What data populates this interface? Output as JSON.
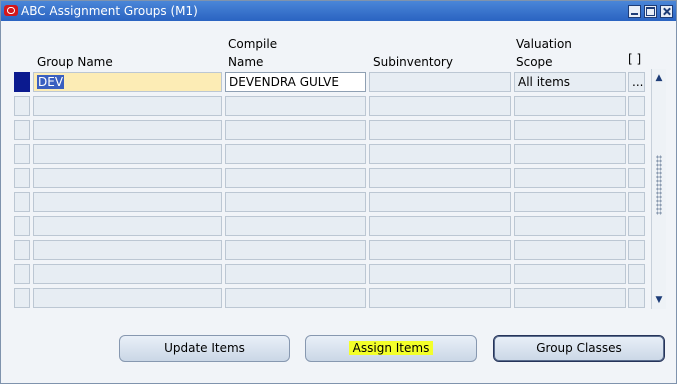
{
  "window": {
    "title": "ABC Assignment Groups (M1)",
    "controls": [
      "minimize-icon",
      "maximize-icon",
      "close-icon"
    ]
  },
  "table": {
    "headers": {
      "group_name": "Group Name",
      "compile_name_line1": "Compile",
      "compile_name_line2": "Name",
      "subinventory": "Subinventory",
      "valuation_line1": "Valuation",
      "valuation_line2": "Scope",
      "flex": "[ ]"
    },
    "rows": [
      {
        "group_name": "DEV",
        "compile_name": "DEVENDRA GULVE",
        "subinventory": "",
        "valuation_scope": "All items",
        "flex": "..."
      },
      {
        "group_name": "",
        "compile_name": "",
        "subinventory": "",
        "valuation_scope": "",
        "flex": ""
      },
      {
        "group_name": "",
        "compile_name": "",
        "subinventory": "",
        "valuation_scope": "",
        "flex": ""
      },
      {
        "group_name": "",
        "compile_name": "",
        "subinventory": "",
        "valuation_scope": "",
        "flex": ""
      },
      {
        "group_name": "",
        "compile_name": "",
        "subinventory": "",
        "valuation_scope": "",
        "flex": ""
      },
      {
        "group_name": "",
        "compile_name": "",
        "subinventory": "",
        "valuation_scope": "",
        "flex": ""
      },
      {
        "group_name": "",
        "compile_name": "",
        "subinventory": "",
        "valuation_scope": "",
        "flex": ""
      },
      {
        "group_name": "",
        "compile_name": "",
        "subinventory": "",
        "valuation_scope": "",
        "flex": ""
      },
      {
        "group_name": "",
        "compile_name": "",
        "subinventory": "",
        "valuation_scope": "",
        "flex": ""
      },
      {
        "group_name": "",
        "compile_name": "",
        "subinventory": "",
        "valuation_scope": "",
        "flex": ""
      }
    ]
  },
  "scrollbar": {
    "up": "▲",
    "down": "▼"
  },
  "buttons": {
    "update_items": "Update Items",
    "assign_items": "Assign Items",
    "group_classes": "Group Classes"
  },
  "colors": {
    "title_bar": "#2a63c1",
    "active_field": "#fcecb5",
    "record_indicator": "#0b1a8f",
    "highlight": "#f3ff2a"
  }
}
